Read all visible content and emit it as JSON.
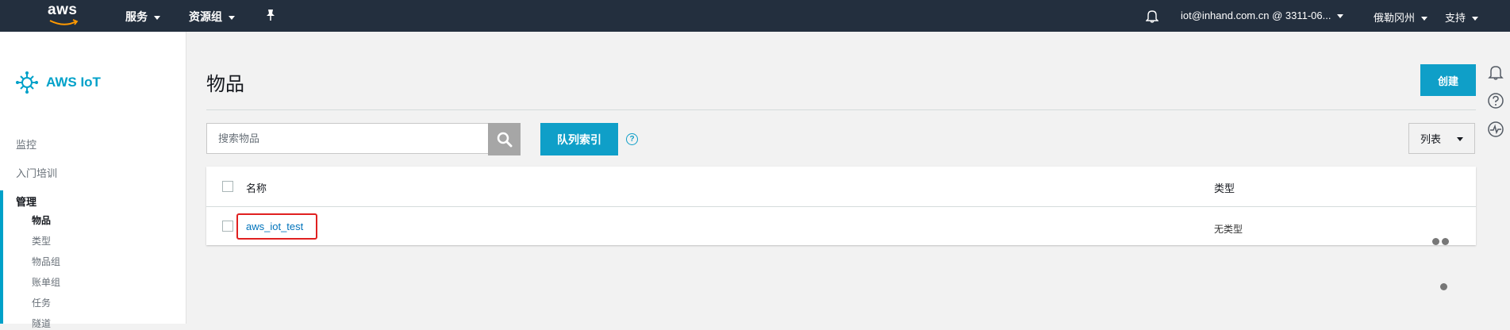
{
  "topnav": {
    "logo_text": "aws",
    "services": "服务",
    "resource_groups": "资源组",
    "account": "iot@inhand.com.cn @ 3311-06...",
    "region": "俄勒冈州",
    "support": "支持"
  },
  "sidebar": {
    "brand": "AWS IoT",
    "monitor": "监控",
    "onboard": "入门培训",
    "manage": "管理",
    "items": [
      {
        "label": "物品",
        "active": true
      },
      {
        "label": "类型"
      },
      {
        "label": "物品组"
      },
      {
        "label": "账单组"
      },
      {
        "label": "任务"
      },
      {
        "label": "隧道"
      }
    ]
  },
  "main": {
    "title": "物品",
    "create_label": "创建",
    "search_placeholder": "搜索物品",
    "queue_index_label": "队列索引",
    "help_glyph": "?",
    "view_label": "列表",
    "table": {
      "col_name": "名称",
      "col_type": "类型",
      "rows": [
        {
          "name": "aws_iot_test",
          "type": "无类型"
        }
      ]
    }
  },
  "colors": {
    "nav_bg": "#232f3e",
    "accent": "#0f9fc8",
    "link": "#0073bb",
    "highlight": "#e02020"
  }
}
